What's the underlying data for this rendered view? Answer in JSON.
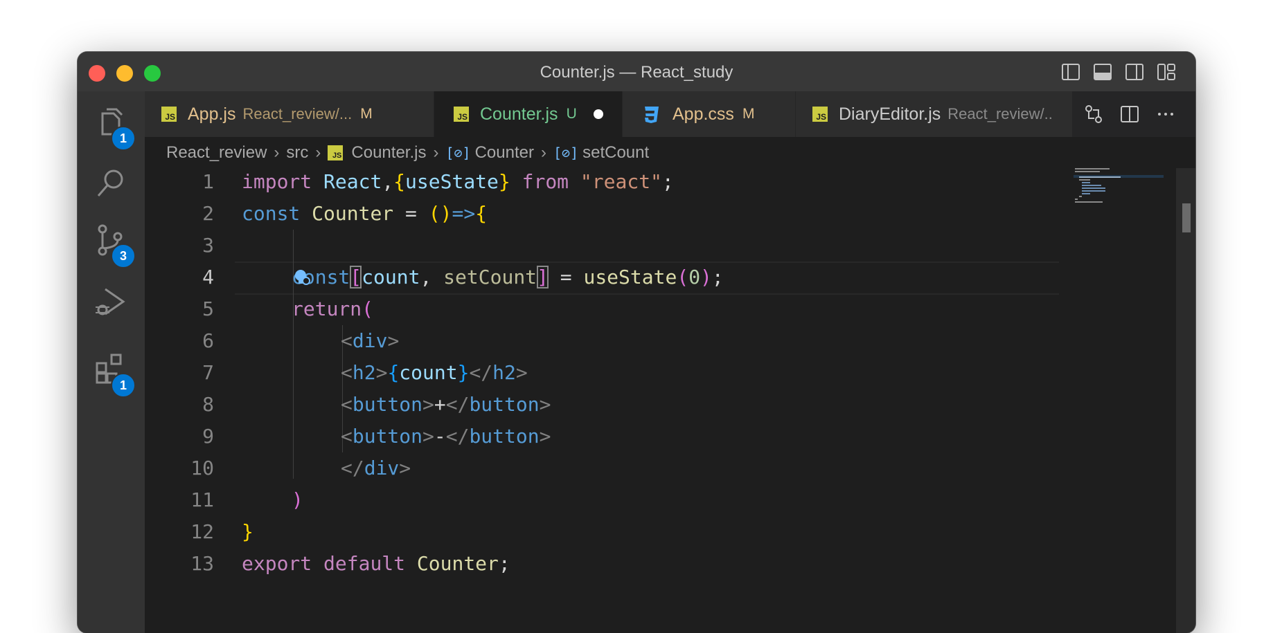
{
  "window": {
    "title": "Counter.js — React_study"
  },
  "activity_bar": {
    "explorer_badge": "1",
    "source_control_badge": "3",
    "extensions_badge": "1"
  },
  "tabs": [
    {
      "name": "App.js",
      "description": "React_review/...",
      "status": "M",
      "icon": "js-icon"
    },
    {
      "name": "Counter.js",
      "description": "",
      "status": "U",
      "icon": "js-icon",
      "active": true,
      "dirty": true
    },
    {
      "name": "App.css",
      "description": "",
      "status": "M",
      "icon": "css-icon"
    },
    {
      "name": "DiaryEditor.js",
      "description": "React_review/..",
      "status": "",
      "icon": "js-icon"
    }
  ],
  "breadcrumb": {
    "folder": "React_review",
    "subfolder": "src",
    "file": "Counter.js",
    "symbol1": "Counter",
    "symbol2": "setCount"
  },
  "editor": {
    "line_numbers": [
      "1",
      "2",
      "3",
      "4",
      "5",
      "6",
      "7",
      "8",
      "9",
      "10",
      "11",
      "12",
      "13"
    ],
    "current_line": "4",
    "code": {
      "l1": {
        "import": "import",
        "react": "React",
        "comma": ",",
        "ob": "{",
        "usestate": "useState",
        "cb": "}",
        "from": "from",
        "str": "\"react\"",
        "semi": ";"
      },
      "l2": {
        "const": "const",
        "name": "Counter",
        "eq": " = ",
        "parens": "()",
        "arrow": "=>",
        "ob": "{"
      },
      "l4": {
        "const": "const",
        "ob": "[",
        "count": "count",
        "comma": ", ",
        "setcount": "setCount",
        "cb": "]",
        "eq": " = ",
        "fn": "useState",
        "op": "(",
        "zero": "0",
        "cp": ")",
        "semi": ";"
      },
      "l5": {
        "return": "return",
        "op": "("
      },
      "l6": {
        "lt": "<",
        "tag": "div",
        "gt": ">"
      },
      "l7": {
        "lt": "<",
        "tag": "h2",
        "gt": ">",
        "ob": "{",
        "count": "count",
        "cb": "}",
        "lt2": "</",
        "tag2": "h2",
        "gt2": ">"
      },
      "l8": {
        "lt": "<",
        "tag": "button",
        "gt": ">",
        "text": "+",
        "lt2": "</",
        "tag2": "button",
        "gt2": ">"
      },
      "l9": {
        "lt": "<",
        "tag": "button",
        "gt": ">",
        "text": "-",
        "lt2": "</",
        "tag2": "button",
        "gt2": ">"
      },
      "l10": {
        "lt": "</",
        "tag": "div",
        "gt": ">"
      },
      "l11": {
        "cp": ")"
      },
      "l12": {
        "cb": "}"
      },
      "l13": {
        "export": "export",
        "default": "default",
        "name": "Counter",
        "semi": ";"
      }
    }
  },
  "colors": {
    "editor_bg": "#1e1e1e",
    "keyword": "#569cd6",
    "control": "#c586c0",
    "function": "#dcdcaa",
    "variable": "#9cdcfe",
    "string": "#ce9178",
    "modified_tab": "#e2c08d",
    "untracked_tab": "#73c991",
    "badge": "#0078d4"
  }
}
